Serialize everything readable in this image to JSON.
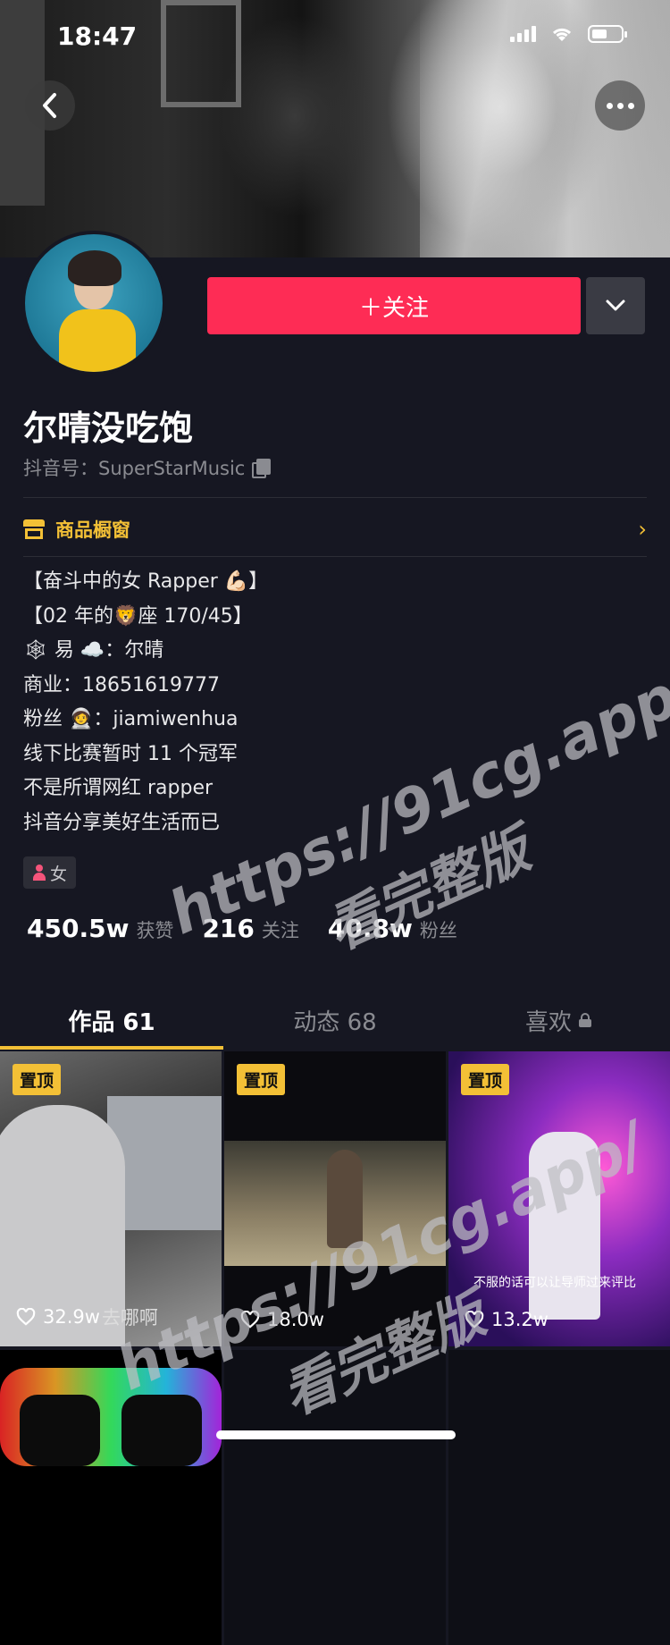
{
  "status_bar": {
    "time": "18:47"
  },
  "profile": {
    "follow_label": "＋关注",
    "name": "尔晴没吃饱",
    "douyin_id": "抖音号：SuperStarMusic",
    "shop_window": "商品橱窗",
    "bio_lines": [
      "【奋斗中的女 Rapper 💪🏻】",
      "【02 年的🦁座 170/45】",
      "🕸 易 ☁️：尔晴",
      "商业：18651619777",
      "粉丝 🧑‍🚀：jiamiwenhua",
      "线下比赛暂时 11 个冠军",
      "不是所谓网红 rapper",
      "抖音分享美好生活而已"
    ],
    "gender": "女",
    "stats": [
      {
        "value": "450.5w",
        "label": "获赞"
      },
      {
        "value": "216",
        "label": "关注"
      },
      {
        "value": "40.8w",
        "label": "粉丝"
      }
    ]
  },
  "tabs": [
    {
      "label": "作品 61",
      "active": true
    },
    {
      "label": "动态 68",
      "active": false
    },
    {
      "label": "喜欢",
      "active": false,
      "locked": true
    }
  ],
  "videos": [
    {
      "pinned_label": "置顶",
      "likes": "32.9w",
      "caption": "去哪啊"
    },
    {
      "pinned_label": "置顶",
      "likes": "18.0w",
      "caption": ""
    },
    {
      "pinned_label": "置顶",
      "likes": "13.2w",
      "caption": "不服的话可以让导师过来评比"
    },
    {
      "pinned_label": "",
      "likes": "",
      "caption": ""
    }
  ],
  "watermark": {
    "line1": "https://91cg.app/",
    "line2": "看完整版"
  },
  "colors": {
    "background": "#161722",
    "follow_button": "#fe2c55",
    "accent_yellow": "#f3c036",
    "muted_text": "#8a8b91"
  }
}
